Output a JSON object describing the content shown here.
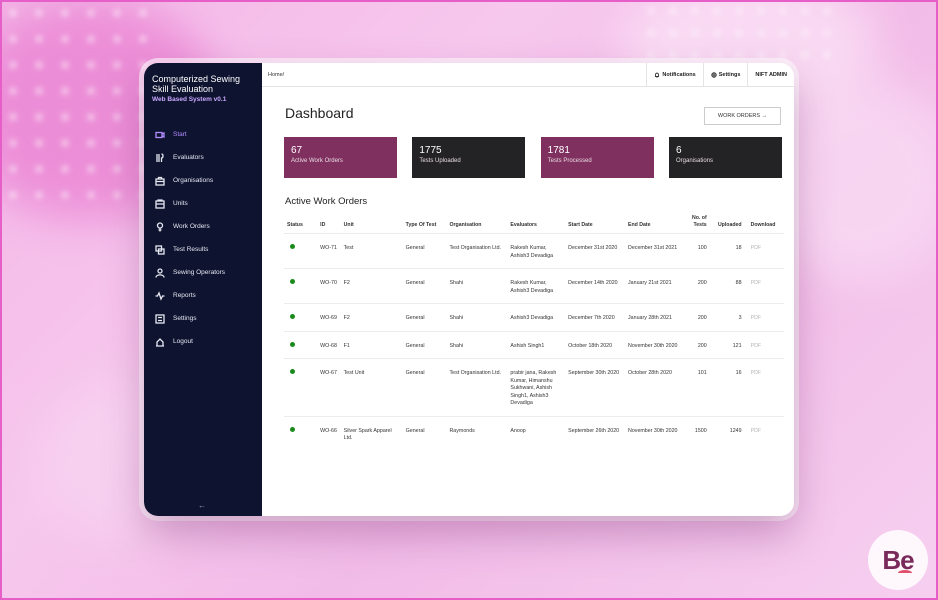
{
  "app": {
    "title": "Computerized Sewing Skill Evaluation",
    "subtitle": "Web Based System v0.1"
  },
  "sidebar": {
    "items": [
      {
        "label": "Start",
        "icon": "start-icon",
        "active": true
      },
      {
        "label": "Evaluators",
        "icon": "evaluators-icon"
      },
      {
        "label": "Organisations",
        "icon": "organisations-icon"
      },
      {
        "label": "Units",
        "icon": "units-icon"
      },
      {
        "label": "Work Orders",
        "icon": "work-orders-icon"
      },
      {
        "label": "Test Results",
        "icon": "test-results-icon"
      },
      {
        "label": "Sewing Operators",
        "icon": "sewing-operators-icon"
      },
      {
        "label": "Reports",
        "icon": "reports-icon"
      },
      {
        "label": "Settings",
        "icon": "settings-icon"
      },
      {
        "label": "Logout",
        "icon": "logout-icon"
      }
    ],
    "collapse_label": "←"
  },
  "topbar": {
    "breadcrumb": "Home/",
    "notifications": "Notifications",
    "settings": "Settings",
    "user": "NIFT ADMIN"
  },
  "dashboard": {
    "title": "Dashboard",
    "work_orders_button": "WORK ORDERS →",
    "cards": [
      {
        "value": "67",
        "label": "Active Work Orders",
        "color": "#80305f"
      },
      {
        "value": "1775",
        "label": "Tests Uploaded",
        "color": "#232325"
      },
      {
        "value": "1781",
        "label": "Tests Processed",
        "color": "#80305f"
      },
      {
        "value": "6",
        "label": "Organisations",
        "color": "#232325"
      }
    ],
    "section_title": "Active Work Orders"
  },
  "table": {
    "headers": [
      "Status",
      "ID",
      "Unit",
      "Type Of Test",
      "Organisation",
      "Evaluators",
      "Start Date",
      "End Date",
      "No. of Tests",
      "Uploaded",
      "Download"
    ],
    "rows": [
      {
        "id": "WO-71",
        "unit": "Test",
        "type": "General",
        "org": "Test Organisation Ltd.",
        "evaluators": "Rakesh Kumar, Ashish3 Devadiga",
        "start": "December 31st 2020",
        "end": "December 31st 2021",
        "tests": "100",
        "uploaded": "18",
        "download": "PDF"
      },
      {
        "id": "WO-70",
        "unit": "F2",
        "type": "General",
        "org": "Shahi",
        "evaluators": "Rakesh Kumar, Ashish3 Devadiga",
        "start": "December 14th 2020",
        "end": "January 21st 2021",
        "tests": "200",
        "uploaded": "88",
        "download": "PDF"
      },
      {
        "id": "WO-69",
        "unit": "F2",
        "type": "General",
        "org": "Shahi",
        "evaluators": "Ashish3 Devadiga",
        "start": "December 7th 2020",
        "end": "January 28th 2021",
        "tests": "200",
        "uploaded": "3",
        "download": "PDF"
      },
      {
        "id": "WO-68",
        "unit": "F1",
        "type": "General",
        "org": "Shahi",
        "evaluators": "Ashish Singh1",
        "start": "October 18th 2020",
        "end": "November 30th 2020",
        "tests": "200",
        "uploaded": "121",
        "download": "PDF"
      },
      {
        "id": "WO-67",
        "unit": "Test Unit",
        "type": "General",
        "org": "Test Organisation Ltd.",
        "evaluators": "prabir jana, Rakesh Kumar, Himanshu Sukhwani, Ashish Singh1, Ashish3 Devadiga",
        "start": "September 30th 2020",
        "end": "October 28th 2020",
        "tests": "101",
        "uploaded": "16",
        "download": "PDF"
      },
      {
        "id": "WO-66",
        "unit": "Silver Spark Apparel Ltd.",
        "type": "General",
        "org": "Raymonds",
        "evaluators": "Anoop",
        "start": "September 26th 2020",
        "end": "November 30th 2020",
        "tests": "1500",
        "uploaded": "1249",
        "download": "PDF"
      }
    ]
  },
  "watermark": {
    "text": "Be"
  }
}
